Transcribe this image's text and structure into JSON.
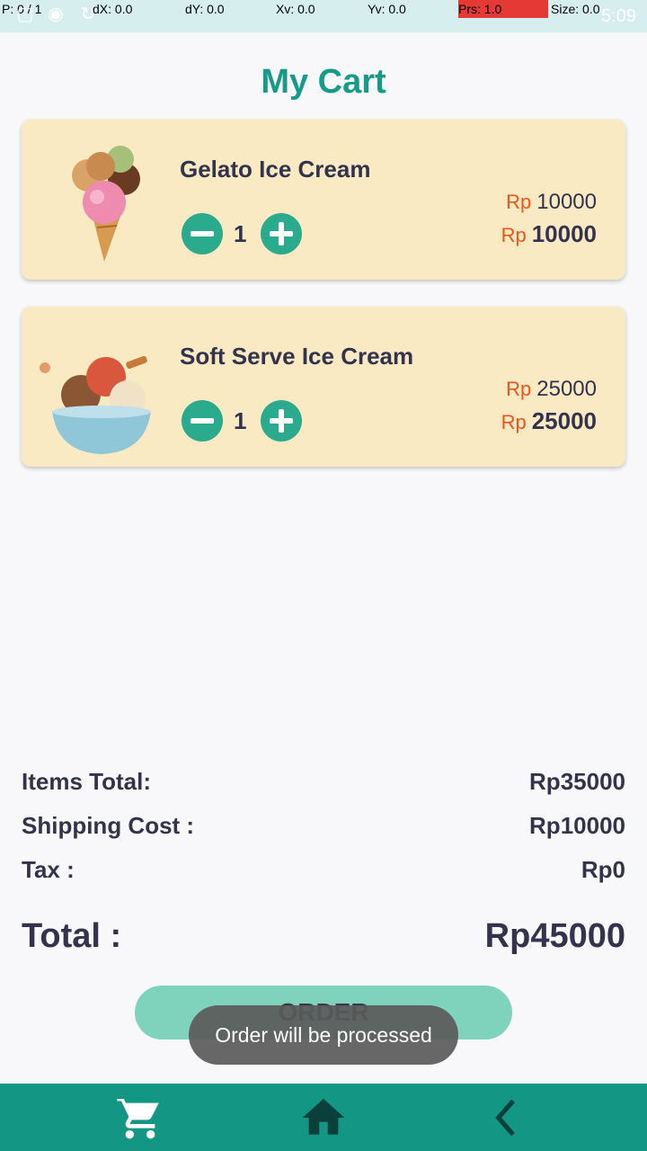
{
  "debug": {
    "p": "P: 0 / 1",
    "dx": "dX: 0.0",
    "dy": "dY: 0.0",
    "xv": "Xv: 0.0",
    "yv": "Yv: 0.0",
    "prs": "Prs: 1.0",
    "size": "Size: 0.0",
    "clock": "5:09"
  },
  "page_title": "My Cart",
  "items": [
    {
      "name": "Gelato Ice Cream",
      "qty": "1",
      "currency": "Rp",
      "unit_price": "10000",
      "subtotal": "10000"
    },
    {
      "name": "Soft Serve Ice Cream",
      "qty": "1",
      "currency": "Rp",
      "unit_price": "25000",
      "subtotal": "25000"
    }
  ],
  "summary": {
    "items_total_label": "Items Total:",
    "items_total_value": "Rp35000",
    "shipping_label": "Shipping Cost :",
    "shipping_value": "Rp10000",
    "tax_label": "Tax :",
    "tax_value": "Rp0",
    "total_label": "Total :",
    "total_value": "Rp45000"
  },
  "order_button": "ORDER",
  "toast": "Order will be processed",
  "nav": {
    "icons": [
      "cart-icon",
      "home-icon",
      "back-icon"
    ]
  },
  "colors": {
    "accent": "#169b8a",
    "card": "#faeac4",
    "button": "#2bab8d",
    "currency": "#f0541a",
    "navbar": "#139784"
  }
}
